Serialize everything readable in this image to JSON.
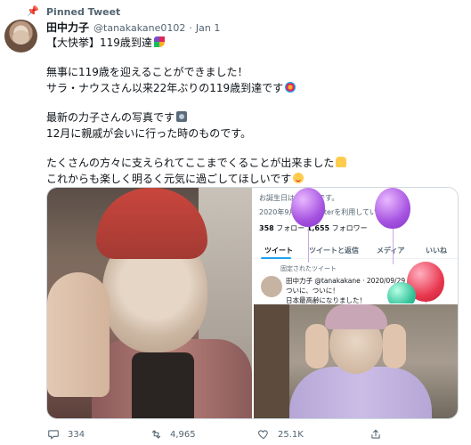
{
  "pinned_label": "Pinned Tweet",
  "author": {
    "name": "田中力子",
    "handle": "@tanakakane0102",
    "date": "Jan 1"
  },
  "tweet_lines": [
    "【大快挙】119歳到達",
    "",
    "無事に119歳を迎えることができました！",
    "サラ・ナウスさん以来22年ぶりの119歳到達です",
    "",
    "最新の力子さんの写真です",
    "12月に親戚が会いに行った時のものです。",
    "",
    "たくさんの方々に支えられてここまでくることが出来ました",
    "これからも楽しく明るく元気に過ごしてほしいです"
  ],
  "embedded_screenshot": {
    "line1": "お誕生日は1月2日です。",
    "line2": "2020年9月からTwitterを利用しています",
    "stats_following_count": "358",
    "stats_following_label": "フォロー",
    "stats_followers_count": "1,655",
    "stats_followers_label": "フォロワー",
    "tabs": [
      "ツイート",
      "ツイートと返信",
      "メディア",
      "いいね"
    ],
    "pinned_label": "固定されたツイート",
    "name_line": "田中力子 @tanakakane · 2020/09/29",
    "text_line1": "ついに、ついに！",
    "text_line2": "日本最高齢になりました！"
  },
  "actions": {
    "reply_count": "334",
    "retweet_count": "4,965",
    "like_count": "25.1K"
  },
  "icons": {
    "pin": "pin-icon",
    "reply": "reply-icon",
    "retweet": "retweet-icon",
    "like": "heart-icon",
    "share": "share-icon"
  },
  "colors": {
    "text": "#0f1419",
    "secondary": "#536471",
    "accent": "#1da1f2"
  }
}
